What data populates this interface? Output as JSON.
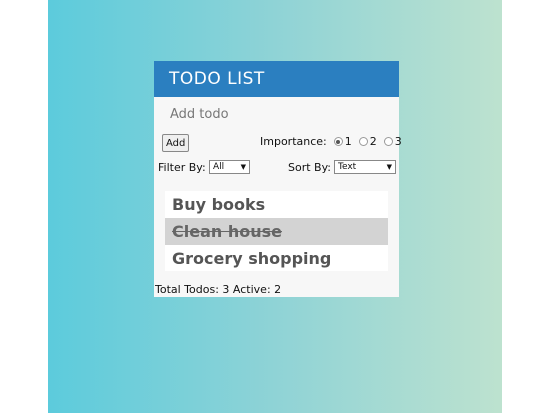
{
  "header": {
    "title": "TODO LIST"
  },
  "add": {
    "placeholder": "Add todo",
    "button_label": "Add"
  },
  "importance": {
    "label": "Importance:",
    "options": [
      "1",
      "2",
      "3"
    ],
    "selected": "1"
  },
  "filter": {
    "label": "Filter By:",
    "value": "All"
  },
  "sort": {
    "label": "Sort By:",
    "value": "Text"
  },
  "todos": [
    {
      "text": "Buy books",
      "done": false
    },
    {
      "text": "Clean house",
      "done": true
    },
    {
      "text": "Grocery shopping",
      "done": false
    }
  ],
  "footer": {
    "total_label": "Total Todos:",
    "total": "3",
    "active_label": "Active:",
    "active": "2"
  },
  "colors": {
    "header": "#2b7fc0",
    "completed_row": "#d3d3d3"
  }
}
